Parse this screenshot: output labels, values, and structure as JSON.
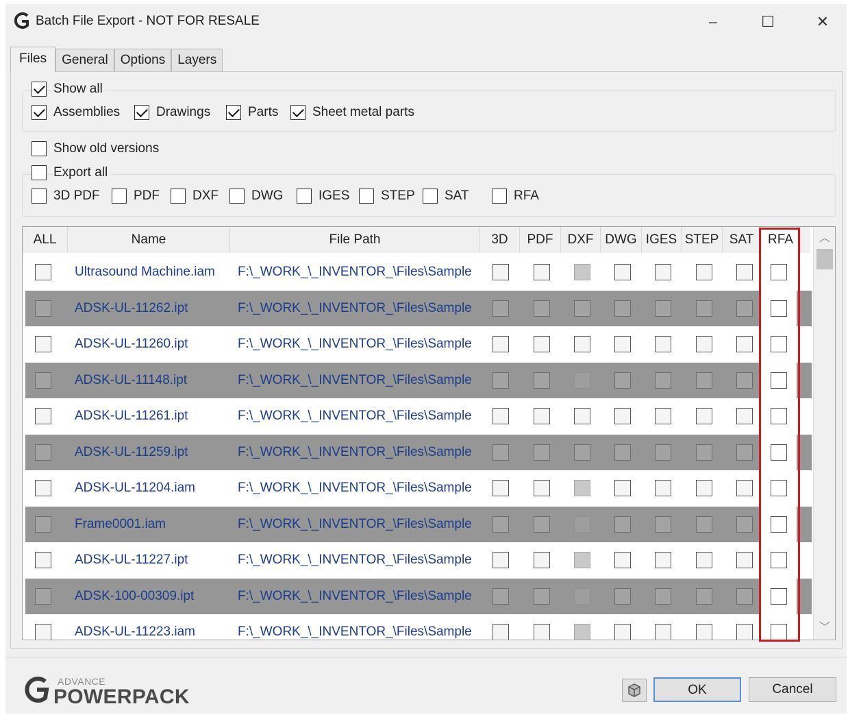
{
  "window": {
    "title": "Batch File Export - NOT FOR RESALE",
    "controls": {
      "minimize": "–",
      "maximize": "☐",
      "close": "✕"
    }
  },
  "tabs": [
    {
      "label": "Files",
      "active": true
    },
    {
      "label": "General",
      "active": false
    },
    {
      "label": "Options",
      "active": false
    },
    {
      "label": "Layers",
      "active": false
    }
  ],
  "filters": {
    "show_all": {
      "label": "Show all",
      "checked": true
    },
    "assemblies": {
      "label": "Assemblies",
      "checked": true
    },
    "drawings": {
      "label": "Drawings",
      "checked": true
    },
    "parts": {
      "label": "Parts",
      "checked": true
    },
    "sheet_metal": {
      "label": "Sheet metal parts",
      "checked": true
    },
    "show_old_versions": {
      "label": "Show old versions",
      "checked": false
    }
  },
  "export": {
    "export_all": {
      "label": "Export all",
      "checked": false
    },
    "formats": [
      {
        "label": "3D PDF",
        "checked": false
      },
      {
        "label": "PDF",
        "checked": false
      },
      {
        "label": "DXF",
        "checked": false
      },
      {
        "label": "DWG",
        "checked": false
      },
      {
        "label": "IGES",
        "checked": false
      },
      {
        "label": "STEP",
        "checked": false
      },
      {
        "label": "SAT",
        "checked": false
      },
      {
        "label": "RFA",
        "checked": false
      }
    ]
  },
  "grid": {
    "columns": [
      "ALL",
      "Name",
      "File Path",
      "3D",
      "PDF",
      "DXF",
      "DWG",
      "IGES",
      "STEP",
      "SAT",
      "RFA"
    ],
    "rows": [
      {
        "name": "Ultrasound Machine.iam",
        "path": "F:\\_WORK_\\_INVENTOR_\\Files\\Sample",
        "dxf_disabled": true
      },
      {
        "name": "ADSK-UL-11262.ipt",
        "path": "F:\\_WORK_\\_INVENTOR_\\Files\\Sample",
        "dxf_disabled": false
      },
      {
        "name": "ADSK-UL-11260.ipt",
        "path": "F:\\_WORK_\\_INVENTOR_\\Files\\Sample",
        "dxf_disabled": false
      },
      {
        "name": "ADSK-UL-11148.ipt",
        "path": "F:\\_WORK_\\_INVENTOR_\\Files\\Sample",
        "dxf_disabled": true
      },
      {
        "name": "ADSK-UL-11261.ipt",
        "path": "F:\\_WORK_\\_INVENTOR_\\Files\\Sample",
        "dxf_disabled": false
      },
      {
        "name": "ADSK-UL-11259.ipt",
        "path": "F:\\_WORK_\\_INVENTOR_\\Files\\Sample",
        "dxf_disabled": false
      },
      {
        "name": "ADSK-UL-11204.iam",
        "path": "F:\\_WORK_\\_INVENTOR_\\Files\\Sample",
        "dxf_disabled": true
      },
      {
        "name": "Frame0001.iam",
        "path": "F:\\_WORK_\\_INVENTOR_\\Files\\Sample",
        "dxf_disabled": true
      },
      {
        "name": "ADSK-UL-11227.ipt",
        "path": "F:\\_WORK_\\_INVENTOR_\\Files\\Sample",
        "dxf_disabled": true
      },
      {
        "name": "ADSK-100-00309.ipt",
        "path": "F:\\_WORK_\\_INVENTOR_\\Files\\Sample",
        "dxf_disabled": true
      },
      {
        "name": "ADSK-UL-11223.iam",
        "path": "F:\\_WORK_\\_INVENTOR_\\Files\\Sample",
        "dxf_disabled": true
      }
    ]
  },
  "footer": {
    "logo_small": "ADVANCE",
    "logo_big": "POWERPACK",
    "ok_label": "OK",
    "cancel_label": "Cancel"
  },
  "colors": {
    "highlight": "#d01c1c",
    "link_text": "#1c3d8c",
    "alt_row": "#969696"
  }
}
